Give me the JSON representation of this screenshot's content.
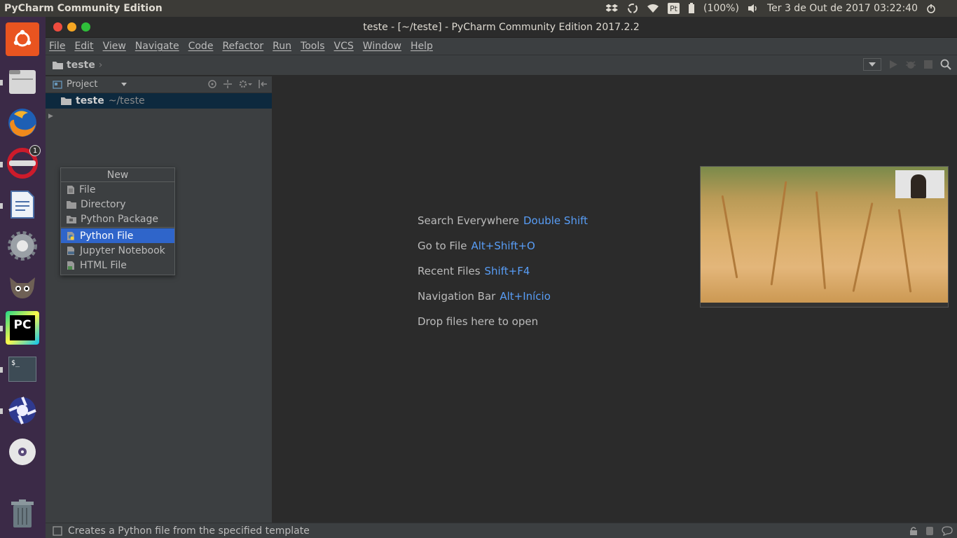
{
  "topbar": {
    "app_title": "PyCharm Community Edition",
    "lang_badge": "Pt",
    "battery": "(100%)",
    "datetime": "Ter  3 de Out de 2017 03:22:40"
  },
  "launcher": {
    "items": [
      {
        "name": "ubuntu-dash-icon"
      },
      {
        "name": "files-icon"
      },
      {
        "name": "firefox-icon"
      },
      {
        "name": "opera-icon",
        "badge": "1"
      },
      {
        "name": "libreoffice-writer-icon"
      },
      {
        "name": "system-settings-icon"
      },
      {
        "name": "gimp-icon"
      },
      {
        "name": "pycharm-icon",
        "label": "PC"
      },
      {
        "name": "terminal-icon",
        "label": "$_"
      },
      {
        "name": "shotwell-icon"
      },
      {
        "name": "dvd-icon"
      },
      {
        "name": "trash-icon"
      }
    ]
  },
  "window": {
    "title": "teste - [~/teste] - PyCharm Community Edition 2017.2.2",
    "menu": [
      "File",
      "Edit",
      "View",
      "Navigate",
      "Code",
      "Refactor",
      "Run",
      "Tools",
      "VCS",
      "Window",
      "Help"
    ],
    "breadcrumb": "teste"
  },
  "project_panel": {
    "header_label": "Project",
    "root_name": "teste",
    "root_path": "~/teste"
  },
  "new_popup": {
    "title": "New",
    "items": [
      {
        "label": "File",
        "icon": "file-icon"
      },
      {
        "label": "Directory",
        "icon": "folder-icon"
      },
      {
        "label": "Python Package",
        "icon": "package-icon"
      },
      {
        "label": "Python File",
        "icon": "python-file-icon",
        "selected": true
      },
      {
        "label": "Jupyter Notebook",
        "icon": "jupyter-icon"
      },
      {
        "label": "HTML File",
        "icon": "html-file-icon"
      }
    ]
  },
  "editor_hints": [
    {
      "label": "Search Everywhere",
      "key": "Double Shift"
    },
    {
      "label": "Go to File",
      "key": "Alt+Shift+O"
    },
    {
      "label": "Recent Files",
      "key": "Shift+F4"
    },
    {
      "label": "Navigation Bar",
      "key": "Alt+Início"
    },
    {
      "label": "Drop files here to open",
      "key": ""
    }
  ],
  "statusbar": {
    "message": "Creates a Python file from the specified template"
  },
  "colors": {
    "accent_blue": "#589df6",
    "selection": "#2f65ca",
    "launcher_bg": "#3b2a47",
    "close": "#ee4c3e",
    "minimize": "#f5a623",
    "maximize": "#2fbe3a"
  }
}
